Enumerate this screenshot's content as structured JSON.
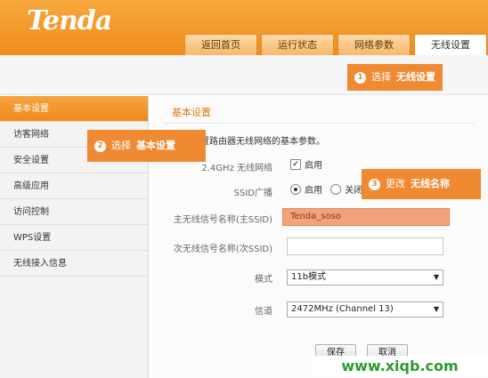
{
  "brand": {
    "logo": "Tenda"
  },
  "tabs": [
    {
      "label": "返回首页"
    },
    {
      "label": "运行状态"
    },
    {
      "label": "网络参数"
    },
    {
      "label": "无线设置"
    }
  ],
  "sidebar": {
    "items": [
      {
        "label": "基本设置"
      },
      {
        "label": "访客网络"
      },
      {
        "label": "安全设置"
      },
      {
        "label": "高级应用"
      },
      {
        "label": "访问控制"
      },
      {
        "label": "WPS设置"
      },
      {
        "label": "无线接入信息"
      }
    ]
  },
  "main": {
    "title": "基本设置",
    "description": "置路由器无线网络的基本参数。",
    "wifi24": {
      "label": "2.4GHz 无线网络",
      "checkbox_label": "启用"
    },
    "ssid_broadcast": {
      "label": "SSID广播",
      "on_label": "启用",
      "off_label": "关闭"
    },
    "main_ssid": {
      "label": "主无线信号名称(主SSID)",
      "value": "Tenda_soso"
    },
    "sub_ssid": {
      "label": "次无线信号名称(次SSID)",
      "value": ""
    },
    "mode": {
      "label": "模式",
      "value": "11b模式"
    },
    "channel": {
      "label": "信道",
      "value": "2472MHz (Channel 13)"
    },
    "save_label": "保存",
    "cancel_label": "取消"
  },
  "callouts": {
    "step1": {
      "num": "1",
      "action": "选择",
      "target": "无线设置"
    },
    "step2": {
      "num": "2",
      "action": "选择",
      "target": "基本设置"
    },
    "step3": {
      "num": "3",
      "action": "更改",
      "target": "无线名称"
    }
  },
  "watermark": "www.xiqb.com",
  "colors": {
    "accent": "#ef8a33",
    "watermark": "#2c9a2c"
  }
}
